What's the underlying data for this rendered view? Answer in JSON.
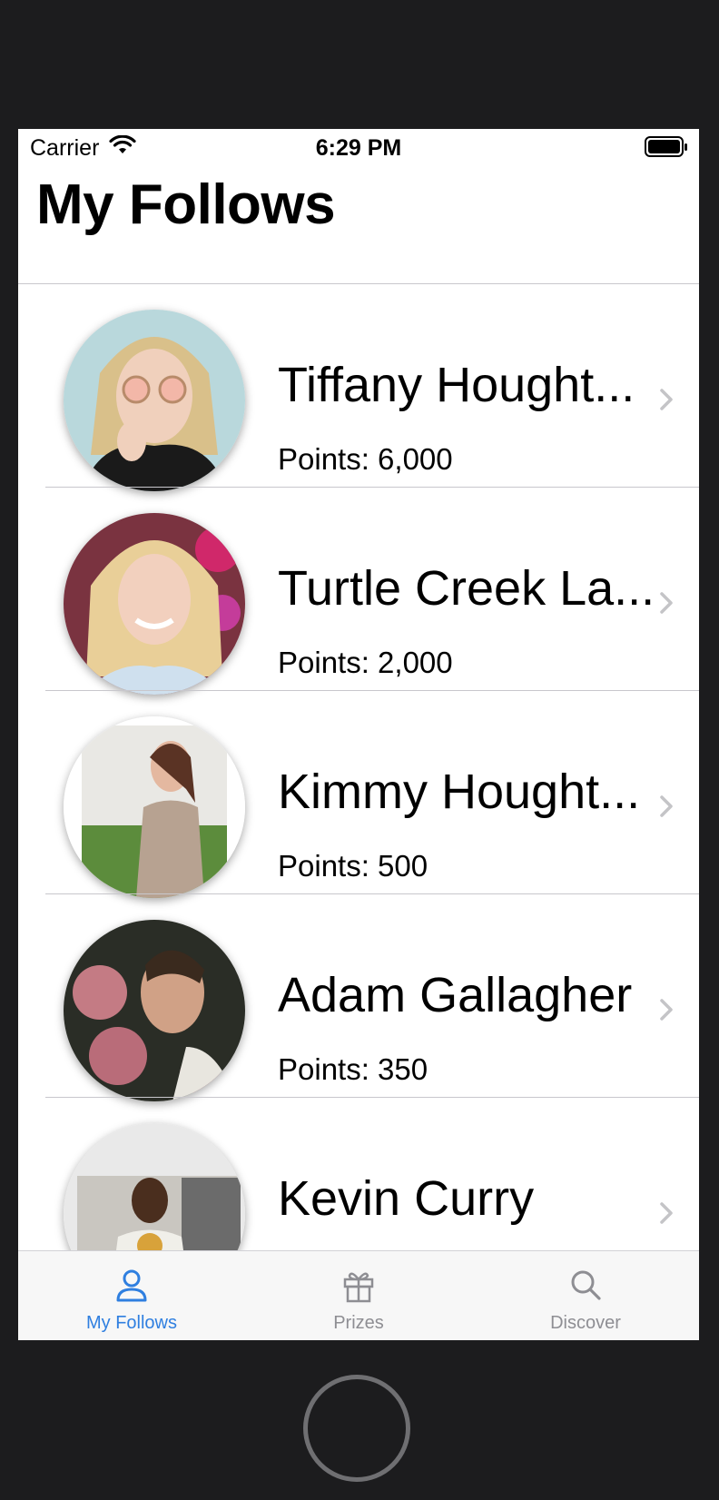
{
  "status_bar": {
    "carrier": "Carrier",
    "time": "6:29 PM"
  },
  "page": {
    "title": "My Follows"
  },
  "follows": [
    {
      "name": "Tiffany Hought...",
      "points": "Points: 6,000"
    },
    {
      "name": "Turtle Creek La...",
      "points": "Points: 2,000"
    },
    {
      "name": "Kimmy Hought...",
      "points": "Points: 500"
    },
    {
      "name": "Adam Gallagher",
      "points": "Points: 350"
    },
    {
      "name": "Kevin Curry",
      "points": ""
    }
  ],
  "tab_bar": {
    "tabs": [
      {
        "label": "My Follows",
        "icon": "person-icon",
        "active": true
      },
      {
        "label": "Prizes",
        "icon": "gift-icon",
        "active": false
      },
      {
        "label": "Discover",
        "icon": "search-icon",
        "active": false
      }
    ]
  },
  "colors": {
    "accent": "#2f7fe0",
    "inactive": "#8e8e93",
    "frame": "#1c1c1e"
  }
}
